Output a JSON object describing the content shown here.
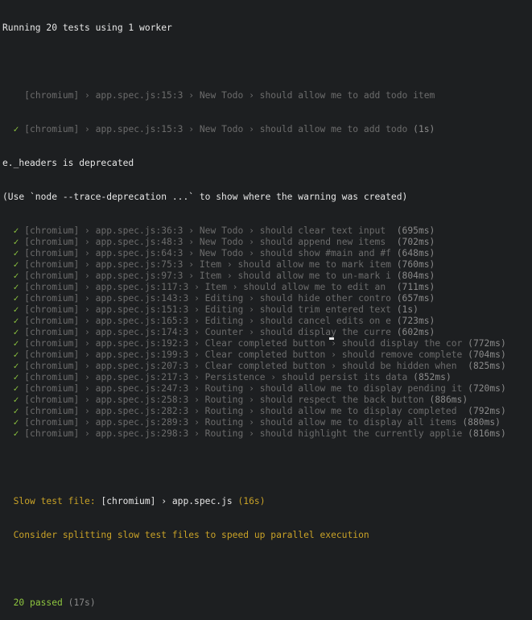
{
  "terminal": {
    "header": "Running 20 tests using 1 worker",
    "pending_line": {
      "text": "[chromium] › app.spec.js:15:3 › New Todo › should allow me to add todo item"
    },
    "first_pass": {
      "check": "✓",
      "text": "[chromium] › app.spec.js:15:3 › New Todo › should allow me to add todo",
      "duration": "(1s)"
    },
    "warning_lines": [
      "e._headers is deprecated",
      "(Use `node --trace-deprecation ...` to show where the warning was created)"
    ],
    "tests": [
      {
        "text": "[chromium] › app.spec.js:36:3 › New Todo › should clear text input ",
        "duration": "(695ms)"
      },
      {
        "text": "[chromium] › app.spec.js:48:3 › New Todo › should append new items ",
        "duration": "(702ms)"
      },
      {
        "text": "[chromium] › app.spec.js:64:3 › New Todo › should show #main and #f",
        "duration": "(648ms)"
      },
      {
        "text": "[chromium] › app.spec.js:75:3 › Item › should allow me to mark item",
        "duration": "(760ms)"
      },
      {
        "text": "[chromium] › app.spec.js:97:3 › Item › should allow me to un-mark i",
        "duration": "(804ms)"
      },
      {
        "text": "[chromium] › app.spec.js:117:3 › Item › should allow me to edit an ",
        "duration": "(711ms)"
      },
      {
        "text": "[chromium] › app.spec.js:143:3 › Editing › should hide other contro",
        "duration": "(657ms)"
      },
      {
        "text": "[chromium] › app.spec.js:151:3 › Editing › should trim entered text",
        "duration": "(1s)"
      },
      {
        "text": "[chromium] › app.spec.js:165:3 › Editing › should cancel edits on e",
        "duration": "(723ms)"
      },
      {
        "text": "[chromium] › app.spec.js:174:3 › Counter › should display the curre",
        "duration": "(602ms)"
      },
      {
        "text": "[chromium] › app.spec.js:192:3 › Clear completed button › should display the cor",
        "duration": "(772ms)"
      },
      {
        "text": "[chromium] › app.spec.js:199:3 › Clear completed button › should remove complete",
        "duration": "(704ms)"
      },
      {
        "text": "[chromium] › app.spec.js:207:3 › Clear completed button › should be hidden when ",
        "duration": "(825ms)"
      },
      {
        "text": "[chromium] › app.spec.js:217:3 › Persistence › should persist its data",
        "duration": "(852ms)"
      },
      {
        "text": "[chromium] › app.spec.js:247:3 › Routing › should allow me to display pending it",
        "duration": "(720ms)"
      },
      {
        "text": "[chromium] › app.spec.js:258:3 › Routing › should respect the back button",
        "duration": "(886ms)"
      },
      {
        "text": "[chromium] › app.spec.js:282:3 › Routing › should allow me to display completed ",
        "duration": "(792ms)"
      },
      {
        "text": "[chromium] › app.spec.js:289:3 › Routing › should allow me to display all items",
        "duration": "(880ms)"
      },
      {
        "text": "[chromium] › app.spec.js:298:3 › Routing › should highlight the currently applie",
        "duration": "(816ms)"
      }
    ],
    "slow_file": {
      "label": "Slow test file: ",
      "file": "[chromium] › app.spec.js",
      "duration": "(16s)"
    },
    "advice": "Consider splitting slow test files to speed up parallel execution",
    "summary": {
      "passed": "20 passed",
      "duration": "(17s)"
    },
    "check_glyph": "✓"
  },
  "colors": {
    "background": "#1d1f21",
    "pass_green": "#8ec63f",
    "dim_gray": "#6c6c6c",
    "warning_yellow": "#c9a227"
  }
}
